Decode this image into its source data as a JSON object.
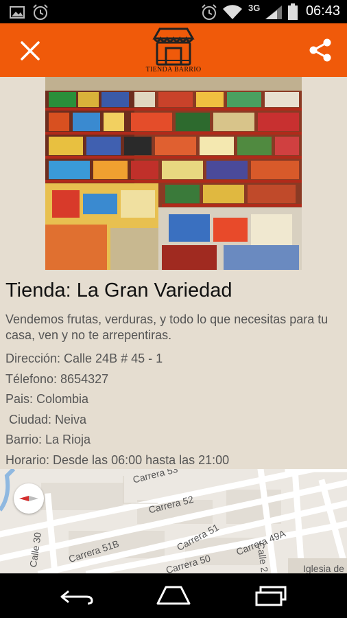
{
  "status_bar": {
    "time": "06:43",
    "network": "3G",
    "icons": [
      "image-icon",
      "alarm-icon",
      "alarm-icon",
      "wifi-icon",
      "signal-icon",
      "battery-icon"
    ]
  },
  "app_bar": {
    "logo_text": "TIENDA BARRIO",
    "color": "#f05a0a",
    "left_icon": "close-icon",
    "right_icon": "share-icon"
  },
  "store": {
    "title": "Tienda: La Gran Variedad",
    "description": "Vendemos frutas, verduras, y todo lo que necesitas para tu casa, ven y no te arrepentiras.",
    "address": "Dirección: Calle 24B # 45 - 1",
    "phone": "Télefono: 8654327",
    "country": "Pais: Colombia",
    "city": " Ciudad: Neiva",
    "neighborhood": "Barrio: La Rioja",
    "hours": "Horario: Desde las 06:00 hasta las 21:00"
  },
  "map": {
    "labels": {
      "carrera53": "Carrera 53",
      "carrera52": "Carrera 52",
      "carrera51": "Carrera 51",
      "carrera51b": "Carrera 51B",
      "carrera50": "Carrera 50",
      "carrera49a": "Carrera 49A",
      "calle30": "Calle 30",
      "calle2": "Calle 2",
      "iglesia": "Iglesia de"
    }
  },
  "nav_bar": {
    "buttons": [
      "back-icon",
      "home-icon",
      "recent-apps-icon"
    ]
  }
}
